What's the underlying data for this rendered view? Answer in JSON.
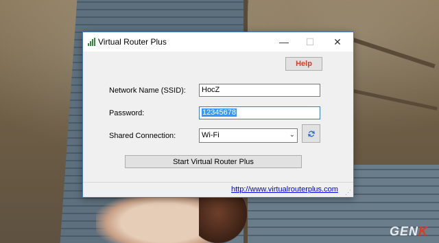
{
  "window": {
    "title": "Virtual Router Plus",
    "controls": {
      "minimize": "—",
      "maximize": "☐",
      "close": "✕"
    }
  },
  "help_button": {
    "label": "Help"
  },
  "form": {
    "ssid_label": "Network Name (SSID):",
    "ssid_value": "HocZ",
    "password_label": "Password:",
    "password_value": "12345678",
    "shared_label": "Shared Connection:",
    "shared_value": "Wi-Fi",
    "dropdown_arrow": "⌄"
  },
  "start_button": {
    "label": "Start Virtual Router Plus"
  },
  "footer": {
    "link": "http://www.virtualrouterplus.com"
  },
  "watermark": {
    "prefix": "GEN",
    "suffix": "K"
  },
  "icons": {
    "app": "signal-bars-icon",
    "refresh": "refresh-icon",
    "resize": "resize-grip-icon"
  },
  "colors": {
    "help_text": "#e03a1e",
    "link": "#0000ee",
    "selection": "#3399ff"
  }
}
